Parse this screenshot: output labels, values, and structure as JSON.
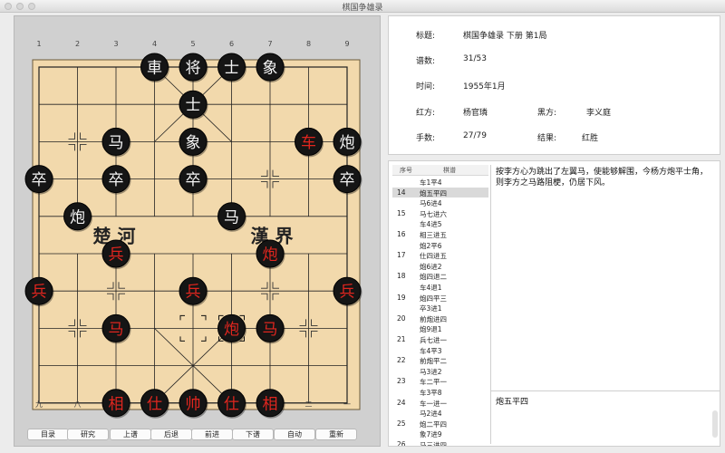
{
  "window": {
    "title": "棋国争雄录"
  },
  "board": {
    "top_labels": [
      "1",
      "2",
      "3",
      "4",
      "5",
      "6",
      "7",
      "8",
      "9"
    ],
    "bottom_labels": [
      "九",
      "八",
      "七",
      "六",
      "五",
      "四",
      "三",
      "二",
      "一"
    ],
    "river_left": "楚  河",
    "river_right": "漢  界",
    "pieces": [
      {
        "t": "車",
        "c": "black",
        "f": 3,
        "r": 0
      },
      {
        "t": "将",
        "c": "black",
        "f": 4,
        "r": 0
      },
      {
        "t": "士",
        "c": "black",
        "f": 5,
        "r": 0
      },
      {
        "t": "象",
        "c": "black",
        "f": 6,
        "r": 0
      },
      {
        "t": "士",
        "c": "black",
        "f": 4,
        "r": 1
      },
      {
        "t": "马",
        "c": "black",
        "f": 2,
        "r": 2
      },
      {
        "t": "象",
        "c": "black",
        "f": 4,
        "r": 2
      },
      {
        "t": "车",
        "c": "red",
        "f": 7,
        "r": 2
      },
      {
        "t": "炮",
        "c": "black",
        "f": 8,
        "r": 2
      },
      {
        "t": "卒",
        "c": "black",
        "f": 0,
        "r": 3
      },
      {
        "t": "卒",
        "c": "black",
        "f": 2,
        "r": 3
      },
      {
        "t": "卒",
        "c": "black",
        "f": 4,
        "r": 3
      },
      {
        "t": "卒",
        "c": "black",
        "f": 8,
        "r": 3
      },
      {
        "t": "炮",
        "c": "black",
        "f": 1,
        "r": 4
      },
      {
        "t": "马",
        "c": "black",
        "f": 5,
        "r": 4
      },
      {
        "t": "兵",
        "c": "red",
        "f": 2,
        "r": 5
      },
      {
        "t": "炮",
        "c": "red",
        "f": 6,
        "r": 5
      },
      {
        "t": "兵",
        "c": "red",
        "f": 0,
        "r": 6
      },
      {
        "t": "兵",
        "c": "red",
        "f": 4,
        "r": 6
      },
      {
        "t": "兵",
        "c": "red",
        "f": 8,
        "r": 6
      },
      {
        "t": "马",
        "c": "red",
        "f": 2,
        "r": 7
      },
      {
        "t": "炮",
        "c": "red",
        "f": 5,
        "r": 7
      },
      {
        "t": "马",
        "c": "red",
        "f": 6,
        "r": 7
      },
      {
        "t": "相",
        "c": "red",
        "f": 2,
        "r": 9
      },
      {
        "t": "仕",
        "c": "red",
        "f": 3,
        "r": 9
      },
      {
        "t": "帅",
        "c": "red",
        "f": 4,
        "r": 9
      },
      {
        "t": "仕",
        "c": "red",
        "f": 5,
        "r": 9
      },
      {
        "t": "相",
        "c": "red",
        "f": 6,
        "r": 9
      }
    ]
  },
  "controls": [
    "目录",
    "研究",
    "上谱",
    "后退",
    "前进",
    "下谱",
    "自动",
    "重新"
  ],
  "info": {
    "title_label": "标题:",
    "title_value": "棋国争雄录 下册 第1局",
    "score_label": "谱数:",
    "score_value": "31/53",
    "time_label": "时间:",
    "time_value": "1955年1月",
    "red_label": "红方:",
    "red_value": "杨官璘",
    "black_label": "黑方:",
    "black_value": "李义庭",
    "moves_label": "手数:",
    "moves_value": "27/79",
    "result_label": "结果:",
    "result_value": "红胜"
  },
  "moves": {
    "headers": [
      "序号",
      "棋谱"
    ],
    "rows": [
      {
        "num": "",
        "mv": "车1平4"
      },
      {
        "num": "14",
        "mv": "炮五平四",
        "sel": true
      },
      {
        "num": "",
        "mv": "马6进4"
      },
      {
        "num": "15",
        "mv": "马七进六"
      },
      {
        "num": "",
        "mv": "车4进5"
      },
      {
        "num": "16",
        "mv": "相三进五"
      },
      {
        "num": "",
        "mv": "炮2平6"
      },
      {
        "num": "17",
        "mv": "仕四进五"
      },
      {
        "num": "",
        "mv": "炮6进2"
      },
      {
        "num": "18",
        "mv": "炮四退二"
      },
      {
        "num": "",
        "mv": "车4退1"
      },
      {
        "num": "19",
        "mv": "炮四平三"
      },
      {
        "num": "",
        "mv": "卒3进1"
      },
      {
        "num": "20",
        "mv": "前炮进四"
      },
      {
        "num": "",
        "mv": "炮9退1"
      },
      {
        "num": "21",
        "mv": "兵七进一"
      },
      {
        "num": "",
        "mv": "车4平3"
      },
      {
        "num": "22",
        "mv": "前炮平二"
      },
      {
        "num": "",
        "mv": "马3进2"
      },
      {
        "num": "23",
        "mv": "车二平一"
      },
      {
        "num": "",
        "mv": "车3平8"
      },
      {
        "num": "24",
        "mv": "车一进一"
      },
      {
        "num": "",
        "mv": "马2进4"
      },
      {
        "num": "25",
        "mv": "炮二平四"
      },
      {
        "num": "",
        "mv": "象7进9"
      },
      {
        "num": "26",
        "mv": "马三进四"
      }
    ],
    "comment": "按李方心为跳出了左翼马，使能够解围，今杨方炮平士角，则李方之马路阻梗，仍居下风。",
    "current": "炮五平四"
  }
}
